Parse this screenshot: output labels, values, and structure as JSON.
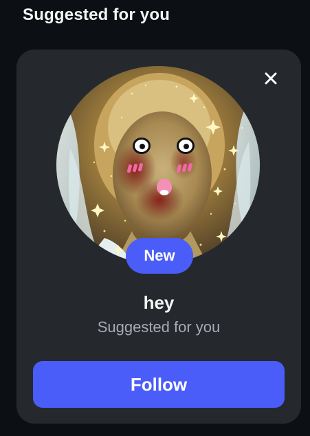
{
  "section": {
    "title": "Suggested for you"
  },
  "card": {
    "badge": "New",
    "name": "hey",
    "subtitle": "Suggested for you",
    "follow_label": "Follow",
    "close_icon": "close-icon"
  },
  "colors": {
    "background": "#0c1014",
    "card_background": "#25292e",
    "accent": "#4a5df9",
    "primary_text": "#f5f5f5",
    "secondary_text": "#a8acb2"
  }
}
